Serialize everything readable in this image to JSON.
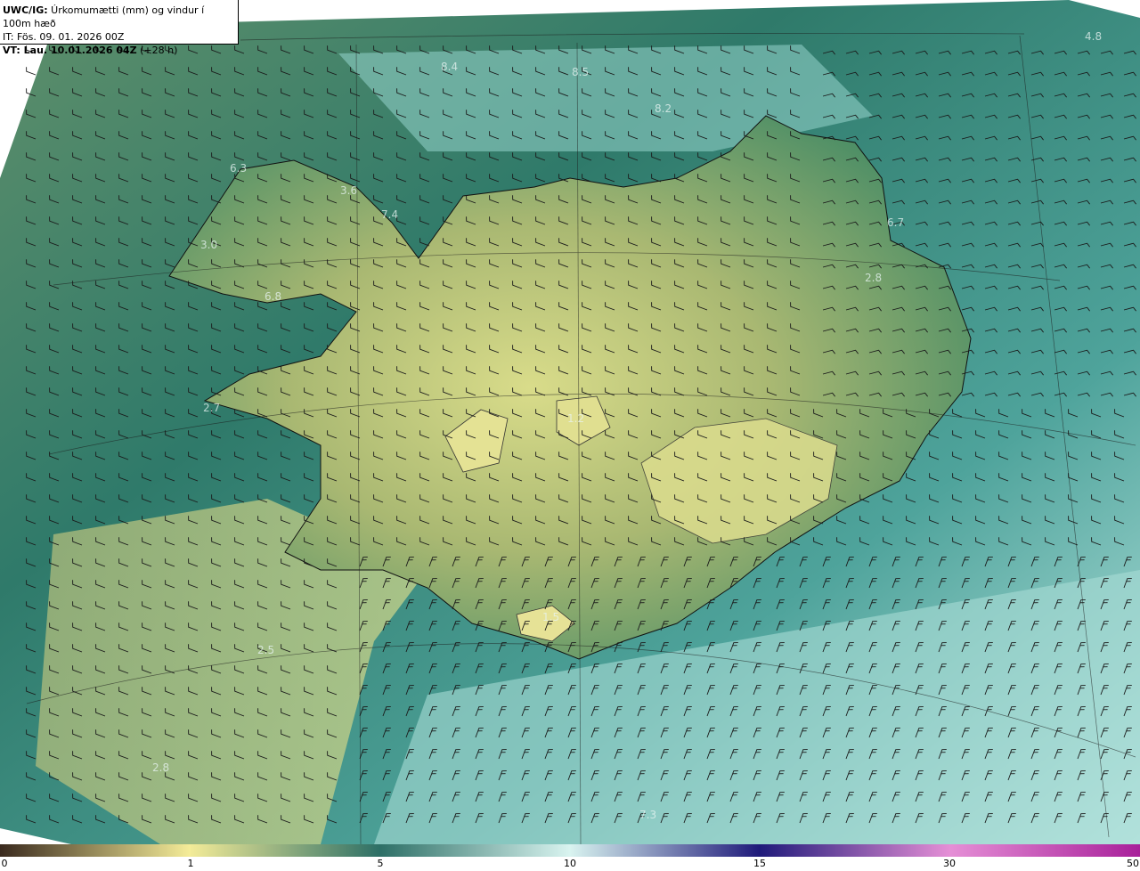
{
  "header": {
    "line1_prefix": "UWC/IG:",
    "line1_text": " Úrkomumætti (mm) og vindur í 100m hæð",
    "line2": "IT: Fös. 09. 01. 2026 00Z",
    "line3_prefix": "VT: Lau. 10.01.2026 04Z",
    "line3_suffix": " (+28 h)"
  },
  "map_labels": [
    {
      "text": "4.8"
    },
    {
      "text": "8.4"
    },
    {
      "text": "8.5"
    },
    {
      "text": "8.2"
    },
    {
      "text": "6.3"
    },
    {
      "text": "3.6"
    },
    {
      "text": "7.4"
    },
    {
      "text": "6.7"
    },
    {
      "text": "3.0"
    },
    {
      "text": "2.8"
    },
    {
      "text": "6.8"
    },
    {
      "text": "2.7"
    },
    {
      "text": "2.5"
    },
    {
      "text": "2.8"
    },
    {
      "text": "7.3"
    },
    {
      "text": "1.5"
    },
    {
      "text": "1.2"
    }
  ],
  "colorbar": {
    "ticks": [
      "0",
      "1",
      "5",
      "10",
      "15",
      "30",
      "50"
    ],
    "colors": {
      "c0": "#3a2a1e",
      "c1": "#f4ec98",
      "c5": "#2d6f66",
      "c10": "#d9f4f0",
      "c15": "#1f1a7a",
      "c30": "#e58fd6",
      "c50": "#a8209a"
    }
  }
}
